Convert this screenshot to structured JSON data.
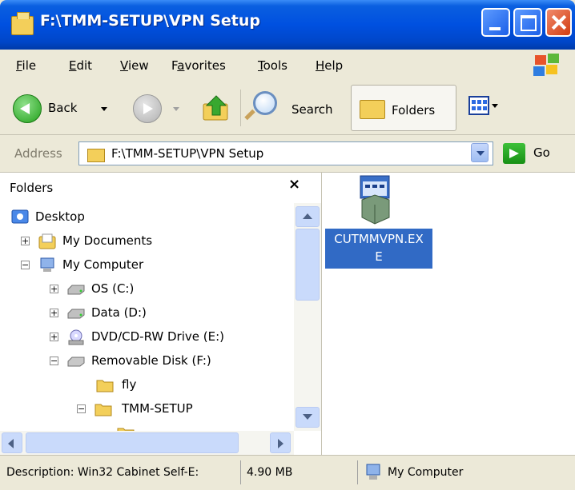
{
  "window": {
    "title": "F:\\TMM-SETUP\\VPN Setup"
  },
  "menu": [
    {
      "label": "File",
      "u": "F",
      "rest": "ile"
    },
    {
      "label": "Edit",
      "u": "E",
      "rest": "dit"
    },
    {
      "label": "View",
      "u": "V",
      "rest": "iew"
    },
    {
      "label": "Favorites",
      "pre": "F",
      "u": "a",
      "rest": "vorites"
    },
    {
      "label": "Tools",
      "u": "T",
      "rest": "ools"
    },
    {
      "label": "Help",
      "u": "H",
      "rest": "elp"
    }
  ],
  "toolbar": {
    "back_label": "Back",
    "search_label": "Search",
    "folders_label": "Folders"
  },
  "address": {
    "label": "Address",
    "value": "F:\\TMM-SETUP\\VPN Setup",
    "go_label": "Go"
  },
  "folders_pane": {
    "title": "Folders",
    "close": "×",
    "tree": [
      {
        "label": "Desktop",
        "icon": "desktop-icon"
      },
      {
        "label": "My Documents",
        "icon": "my-documents-icon",
        "expander": "+"
      },
      {
        "label": "My Computer",
        "icon": "my-computer-icon",
        "expander": "−"
      },
      {
        "label": "OS (C:)",
        "icon": "hard-drive-icon",
        "expander": "+"
      },
      {
        "label": "Data (D:)",
        "icon": "hard-drive-icon",
        "expander": "+"
      },
      {
        "label": "DVD/CD-RW Drive (E:)",
        "icon": "cd-drive-icon",
        "expander": "+"
      },
      {
        "label": "Removable Disk (F:)",
        "icon": "removable-disk-icon",
        "expander": "−"
      },
      {
        "label": "fly",
        "icon": "folder-icon"
      },
      {
        "label": "TMM-SETUP",
        "icon": "folder-icon",
        "expander": "−"
      }
    ]
  },
  "content": {
    "files": [
      {
        "name": "CUTMMVPN.EXE",
        "line1": "CUTMMVPN.EX",
        "line2": "E",
        "icon": "installer-exe-icon",
        "selected": true
      }
    ]
  },
  "status": {
    "description": "Description: Win32 Cabinet Self-E:",
    "size": "4.90 MB",
    "zone": "My Computer"
  }
}
